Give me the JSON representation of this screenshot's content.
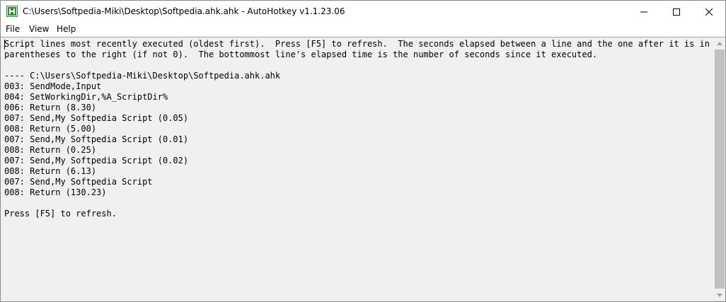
{
  "window": {
    "title": "C:\\Users\\Softpedia-Miki\\Desktop\\Softpedia.ahk.ahk - AutoHotkey v1.1.23.06",
    "app_icon": "autohotkey-icon",
    "controls": {
      "minimize_icon": "minimize-icon",
      "maximize_icon": "maximize-icon",
      "close_icon": "close-icon"
    }
  },
  "menu": {
    "file": "File",
    "view": "View",
    "help": "Help"
  },
  "content": {
    "lines": [
      "Script lines most recently executed (oldest first).  Press [F5] to refresh.  The seconds elapsed between a line and the one after it is in",
      "parentheses to the right (if not 0).  The bottommost line's elapsed time is the number of seconds since it executed.",
      "",
      "---- C:\\Users\\Softpedia-Miki\\Desktop\\Softpedia.ahk.ahk",
      "003: SendMode,Input",
      "004: SetWorkingDir,%A_ScriptDir%",
      "006: Return (8.30)",
      "007: Send,My Softpedia Script (0.05)",
      "008: Return (5.00)",
      "007: Send,My Softpedia Script (0.01)",
      "008: Return (0.25)",
      "007: Send,My Softpedia Script (0.02)",
      "008: Return (6.13)",
      "007: Send,My Softpedia Script",
      "008: Return (130.23)",
      "",
      "Press [F5] to refresh."
    ]
  },
  "colors": {
    "text_area_bg": "#f0f0f0",
    "title_bg": "#ffffff",
    "icon_green": "#2f8a3b"
  }
}
